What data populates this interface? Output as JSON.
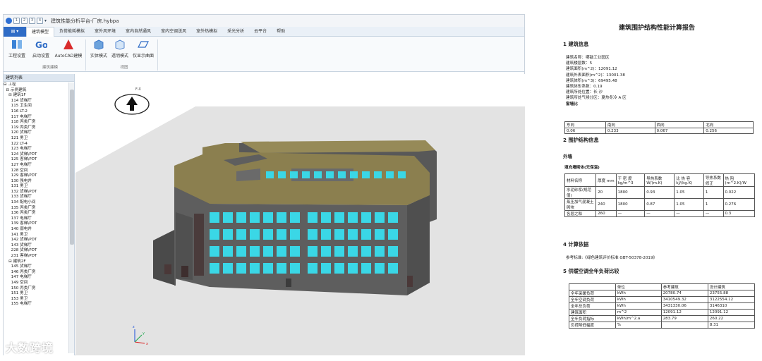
{
  "window": {
    "title": "建筑性能分析平台-厂房.hybpa",
    "quick_access": [
      "1",
      "2",
      "3",
      "4"
    ]
  },
  "menu": {
    "items": [
      "建筑模型",
      "负荷能耗模拟",
      "室外风环境",
      "室内自然通风",
      "室内空调送风",
      "室外热模拟",
      "采光分析",
      "云平台",
      "帮助"
    ]
  },
  "ribbon": {
    "buttons": [
      "工程设置",
      "启动设置",
      "AutoCAD建模",
      "实体模式",
      "透明模式",
      "仅显示曲面"
    ],
    "groups": [
      "建筑建模",
      "视图"
    ]
  },
  "panel": {
    "title": "建筑列表",
    "tree": [
      "⊟ 工程",
      "  ⊟ 示例建筑",
      "    ⊟ 建筑1F",
      "      114 货梯厅",
      "      115 卫生间",
      "      116 LT-2",
      "      117 电梯厅",
      "      118 丙类厂房",
      "      119 丙类厂房",
      "      120 货梯厅",
      "      121 男卫",
      "      122 LT-4",
      "      123 电梯厅",
      "      124 货梯\\PDT",
      "      125 客梯\\PDT",
      "      127 电梯厅",
      "      128 空间",
      "      129 客梯\\PDT",
      "      130 强电井",
      "      131 男卫",
      "      132 货梯\\PDT",
      "      133 货梯厅",
      "      134 配电小间",
      "      135 丙类厂房",
      "      136 丙类厂房",
      "      137 电梯厅",
      "      139 客梯\\PDT",
      "      140 弱电井",
      "      141 男卫",
      "      142 货梯\\PDT",
      "      143 货梯厅",
      "      228 货梯\\PDT",
      "      231 客梯\\PDT",
      "    ⊟ 建筑2F",
      "      145 货梯厅",
      "      146 丙类厂房",
      "      147 电梯厅",
      "      149 空间",
      "      150 丙类厂房",
      "      151 男卫",
      "      153 男卫",
      "      155 电梯厅"
    ]
  },
  "viewport": {
    "compass_label": "F-X",
    "axes": [
      "z",
      "y",
      "x"
    ]
  },
  "report": {
    "title": "建筑围护结构性能计算报告",
    "sec1": "1 建筑信息",
    "info": [
      "建筑名称：哪敲工业园区",
      "建筑楼层数：5",
      "建筑面积(m^2)：12091.12",
      "建筑外表面积(m^2)：13001.38",
      "建筑体积(m^3)：69495.48",
      "建筑体形系数：0.19",
      "建筑所处位置：长 沙",
      "建筑所处气候分区：夏热冬冷 A 区",
      "窗墙比"
    ],
    "wwr_table": [
      [
        "东向",
        "南向",
        "西向",
        "北向"
      ],
      [
        "0.06",
        "0.233",
        "0.067",
        "0.256"
      ]
    ],
    "sec2": "2 围护结构信息",
    "sec2_sub": "外墙",
    "wall_name": "填充墙砌体(无保温)",
    "wall_table": [
      [
        "材料名称",
        "厚度 mm",
        "干 密 度 kg/m^3",
        "导热系数 W/(m.K)",
        "比 热 容 kJ/(kg.K)",
        "导热系数修正",
        "热 阻 (m^2.K)/W"
      ],
      [
        "水泥砂浆(规范值)",
        "20",
        "1800",
        "0.93",
        "1.05",
        "1",
        "0.022"
      ],
      [
        "蒸压加气混凝土砌块",
        "240",
        "1800",
        "0.87",
        "1.05",
        "1",
        "0.276"
      ],
      [
        "各层之和",
        "260",
        "—",
        "—",
        "—",
        "—",
        "0.3"
      ]
    ],
    "sec4": "4 计算依据",
    "reference": "参考标准:《绿色建筑评价标准 GBT-50378-2019》",
    "sec5": "5 供暖空调全年负荷比较",
    "load_table": [
      [
        "",
        "单位",
        "参考建筑",
        "设计建筑"
      ],
      [
        "全年采暖负荷",
        "kWh",
        "20780.74",
        "23755.88"
      ],
      [
        "全年空调负荷",
        "kWh",
        "3410549.32",
        "3122554.12"
      ],
      [
        "全年总负荷",
        "kWh",
        "3431330.06",
        "3146310"
      ],
      [
        "建筑面积",
        "m^2",
        "12091.12",
        "12091.12"
      ],
      [
        "全年负荷指标",
        "kWh/m^2.a",
        "283.79",
        "260.22"
      ],
      [
        "负荷降低幅度",
        "%",
        "",
        "8.31"
      ]
    ]
  },
  "watermark": "大数跨境",
  "colors": {
    "roof": "#8b7f4f",
    "wall": "#5e5e5e",
    "window": "#3ad7e6",
    "ground": "#e3e3e3",
    "accent": "#2f6cc6"
  }
}
